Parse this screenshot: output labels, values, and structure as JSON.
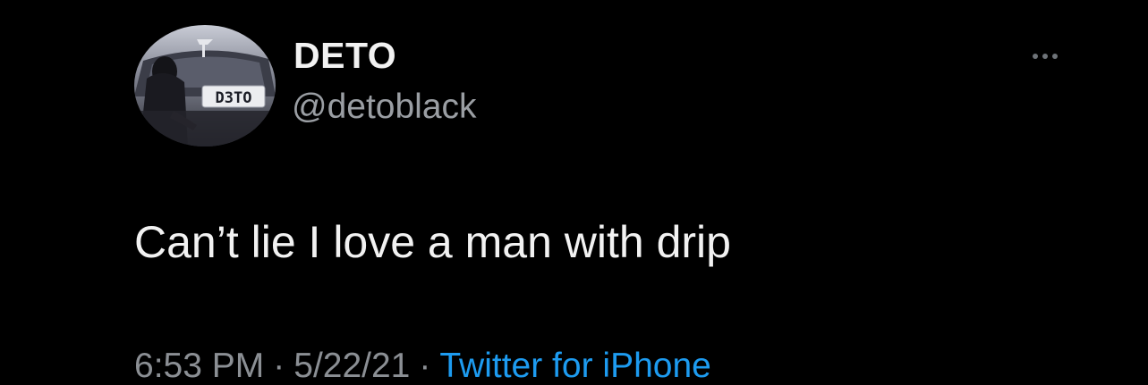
{
  "user": {
    "display_name": "DETO",
    "handle": "@detoblack",
    "avatar_plate_text": "D3TO"
  },
  "tweet": {
    "text": "Can’t lie I love a man with drip",
    "time": "6:53 PM",
    "date": "5/22/21",
    "separator": "·",
    "source": "Twitter for iPhone"
  },
  "menu": {
    "icon": "more-horizontal-icon"
  },
  "colors": {
    "background": "#000000",
    "primary_text": "#f2f2f2",
    "secondary_text": "#9a9ea3",
    "link": "#1d9bf0"
  }
}
